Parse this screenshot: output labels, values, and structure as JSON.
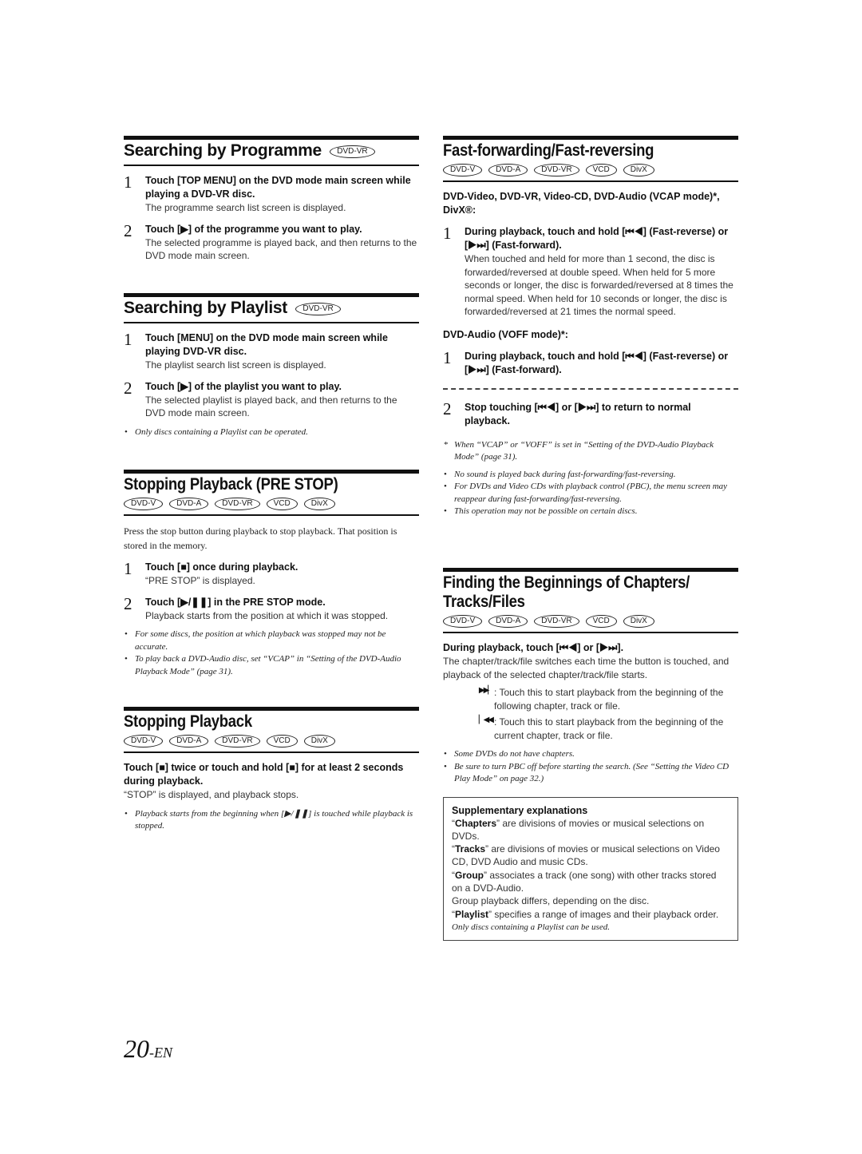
{
  "left": {
    "programme": {
      "title": "Searching by Programme",
      "badge": "DVD-VR",
      "steps": [
        {
          "num": "1",
          "title": "Touch [TOP MENU] on the DVD mode main screen while playing a DVD-VR disc.",
          "desc": "The programme search list screen is displayed."
        },
        {
          "num": "2",
          "title": "Touch [▶] of the programme you want to play.",
          "desc": "The selected programme is played back, and then returns to the DVD mode main screen."
        }
      ]
    },
    "playlist": {
      "title": "Searching by Playlist",
      "badge": "DVD-VR",
      "steps": [
        {
          "num": "1",
          "title": "Touch [MENU] on the DVD mode main screen while playing DVD-VR disc.",
          "desc": "The playlist search list screen is displayed."
        },
        {
          "num": "2",
          "title": "Touch [▶] of the playlist you want to play.",
          "desc": "The selected playlist is played back, and then returns to the DVD mode main screen."
        }
      ],
      "notes": [
        "Only discs containing a Playlist can be operated."
      ]
    },
    "prestop": {
      "title": "Stopping Playback (PRE STOP)",
      "badges": [
        "DVD-V",
        "DVD-A",
        "DVD-VR",
        "VCD",
        "DivX"
      ],
      "intro": "Press the stop button during playback to stop playback.  That position is stored in the memory.",
      "steps": [
        {
          "num": "1",
          "title": "Touch [■] once during playback.",
          "desc": "“PRE STOP” is displayed."
        },
        {
          "num": "2",
          "title": "Touch [▶/❚❚] in the PRE STOP mode.",
          "desc": "Playback starts from the position at which it was stopped."
        }
      ],
      "notes": [
        "For some discs, the position at which playback was stopped may not be accurate.",
        "To play back a DVD-Audio disc, set “VCAP” in “Setting of the DVD-Audio Playback Mode” (page 31)."
      ]
    },
    "stop": {
      "title": "Stopping Playback",
      "badges": [
        "DVD-V",
        "DVD-A",
        "DVD-VR",
        "VCD",
        "DivX"
      ],
      "instruction": "Touch [■] twice or touch and hold [■] for at least 2 seconds during playback.",
      "desc": "“STOP” is displayed, and playback stops.",
      "notes": [
        "Playback starts from the beginning when [▶/❚❚] is touched while playback is stopped."
      ]
    }
  },
  "right": {
    "fast": {
      "title": "Fast-forwarding/Fast-reversing",
      "badges": [
        "DVD-V",
        "DVD-A",
        "DVD-VR",
        "VCD",
        "DivX"
      ],
      "subhead1": "DVD-Video, DVD-VR, Video-CD, DVD-Audio (VCAP mode)*, DivX®:",
      "step1": {
        "num": "1",
        "title": "During playback, touch and hold [⏮◀] (Fast-reverse) or [▶⏭] (Fast-forward).",
        "desc": "When touched and held for more than 1 second, the disc is forwarded/reversed at double speed. When held for 5 more seconds or longer, the disc is forwarded/reversed at 8 times the normal speed. When held for 10 seconds or longer, the disc is forwarded/reversed at 21 times the normal speed."
      },
      "subhead2": "DVD-Audio (VOFF mode)*:",
      "step1b": {
        "num": "1",
        "title": "During playback, touch and hold [⏮◀] (Fast-reverse) or [▶⏭] (Fast-forward)."
      },
      "step2": {
        "num": "2",
        "title": "Stop touching [⏮◀] or [▶⏭] to return to normal playback."
      },
      "footnote": "When “VCAP” or “VOFF” is set in “Setting of the DVD-Audio Playback Mode” (page 31).",
      "notes": [
        "No sound is played back during fast-forwarding/fast-reversing.",
        "For DVDs and Video CDs with playback control (PBC), the menu screen may reappear during fast-forwarding/fast-reversing.",
        "This operation may not be possible on certain discs."
      ]
    },
    "chapters": {
      "title": "Finding the Beginnings of Chapters/ Tracks/Files",
      "badges": [
        "DVD-V",
        "DVD-A",
        "DVD-VR",
        "VCD",
        "DivX"
      ],
      "instruction": "During playback, touch [⏮◀] or [▶⏭].",
      "desc": "The chapter/track/file switches each time the button is touched, and playback of the selected chapter/track/file starts.",
      "icons": [
        {
          "symbol": "▶▶▏",
          "text": ": Touch this to start playback from the beginning of the following chapter, track or file."
        },
        {
          "symbol": "▏◀◀",
          "text": ": Touch this to start playback from the beginning of the current chapter, track or file."
        }
      ],
      "notes": [
        "Some DVDs do not have chapters.",
        "Be sure to turn PBC off before starting the search. (See “Setting the Video CD Play Mode” on page 32.)"
      ]
    },
    "supplementary": {
      "title": "Supplementary explanations",
      "lines": [
        {
          "term": "Chapters",
          "text": "” are divisions of movies or musical selections on DVDs."
        },
        {
          "term": "Tracks",
          "text": "” are divisions of movies or musical selections on Video CD, DVD Audio and music CDs."
        },
        {
          "term": "Group",
          "text": "” associates a track (one song) with other tracks stored on a DVD-Audio."
        },
        {
          "term": "",
          "text": "Group playback differs, depending on the disc."
        },
        {
          "term": "Playlist",
          "text": "” specifies a range of images and their playback order."
        }
      ],
      "note": "Only discs containing a Playlist can be used."
    }
  },
  "footer": {
    "page": "20",
    "suffix": "-EN"
  }
}
